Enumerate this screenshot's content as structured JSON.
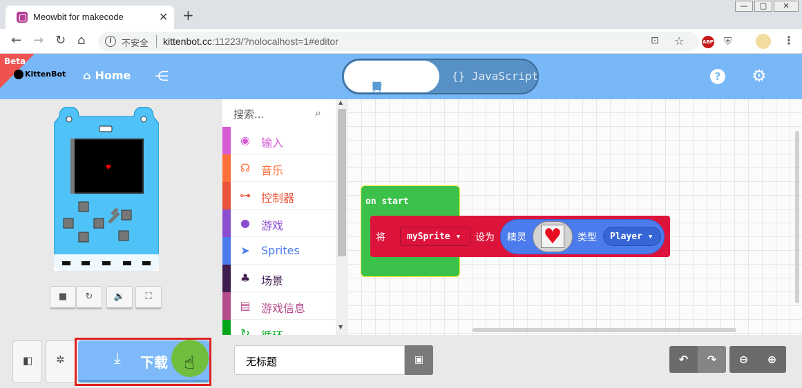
{
  "browser": {
    "tab_title": "Meowbit for makecode",
    "tab_close": "✕",
    "new_tab": "+",
    "security_label": "不安全",
    "url_host": "kittenbot.cc",
    "url_rest": ":11223/?nolocalhost=1#editor",
    "window_buttons": [
      "—",
      "□",
      "✕"
    ]
  },
  "header": {
    "beta": "Beta",
    "logo": "KittenBot",
    "home": "Home",
    "blocks_tab": "方块",
    "js_tab": "{} JavaScript",
    "help": "?"
  },
  "toolbox": {
    "search_placeholder": "搜索...",
    "categories": [
      {
        "label": "输入",
        "color": "#d65cd6",
        "icon": "input-icon"
      },
      {
        "label": "音乐",
        "color": "#fe6f3a",
        "icon": "headphones-icon"
      },
      {
        "label": "控制器",
        "color": "#e8543a",
        "icon": "gamepad-icon"
      },
      {
        "label": "游戏",
        "color": "#8b4ed1",
        "icon": "circle-icon"
      },
      {
        "label": "Sprites",
        "color": "#4b7bec",
        "icon": "paper-plane-icon"
      },
      {
        "label": "场景",
        "color": "#401d4f",
        "icon": "tree-icon"
      },
      {
        "label": "游戏信息",
        "color": "#b44b8a",
        "icon": "id-card-icon"
      },
      {
        "label": "循环",
        "color": "#00a61a",
        "icon": "loop-icon"
      }
    ]
  },
  "workspace": {
    "on_start": "on start",
    "set_word": "将",
    "variable": "mySprite",
    "set_to": "设为",
    "sprite_label": "精灵",
    "kind_label": "类型",
    "kind_value": "Player",
    "colors": {
      "event": "#3bc14a",
      "variable": "#dc143c",
      "sprite": "#4b7bec"
    }
  },
  "bottom": {
    "download_label": "下载",
    "project_name": "无标题"
  }
}
